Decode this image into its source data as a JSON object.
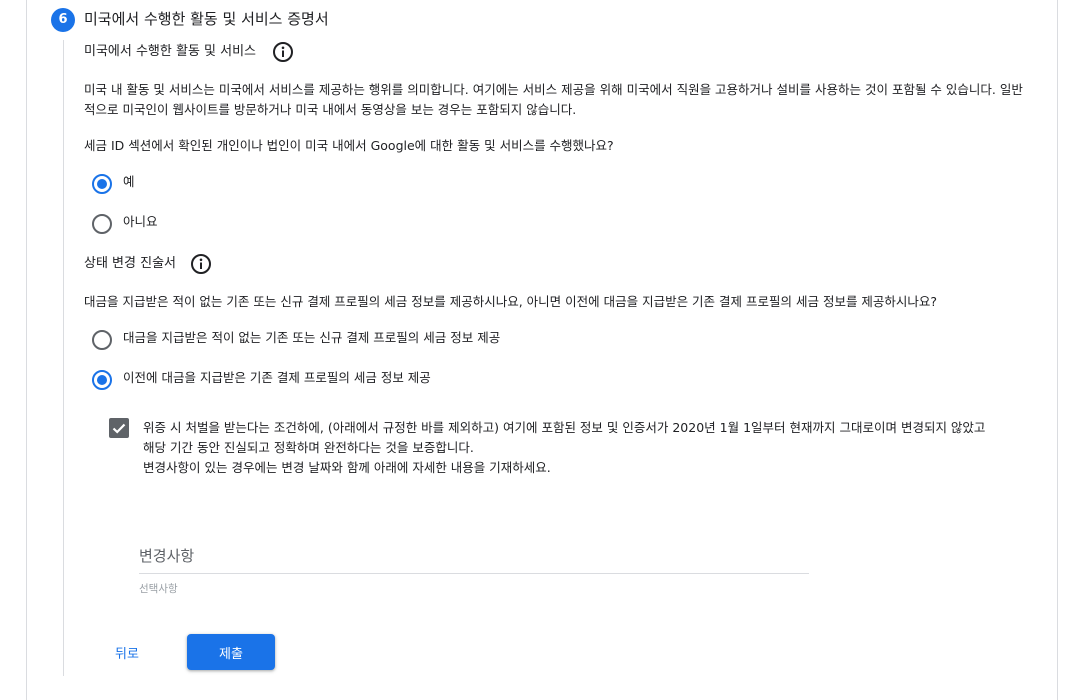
{
  "step": {
    "number": "6",
    "title": "미국에서 수행한 활동 및 서비스 증명서"
  },
  "activities": {
    "heading": "미국에서 수행한 활동 및 서비스",
    "info_icon": "info-icon",
    "description": "미국 내 활동 및 서비스는 미국에서 서비스를 제공하는 행위를 의미합니다. 여기에는 서비스 제공을 위해 미국에서 직원을 고용하거나 설비를 사용하는 것이 포함될 수 있습니다. 일반적으로 미국인이 웹사이트를 방문하거나 미국 내에서 동영상을 보는 경우는 포함되지 않습니다.",
    "question": "세금 ID 섹션에서 확인된 개인이나 법인이 미국 내에서 Google에 대한 활동 및 서비스를 수행했나요?",
    "options": [
      {
        "label": "예",
        "selected": true
      },
      {
        "label": "아니요",
        "selected": false
      }
    ]
  },
  "status_change": {
    "heading": "상태 변경 진술서",
    "info_icon": "info-icon",
    "question": "대금을 지급받은 적이 없는 기존 또는 신규 결제 프로필의 세금 정보를 제공하시나요, 아니면 이전에 대금을 지급받은 기존 결제 프로필의 세금 정보를 제공하시나요?",
    "options": [
      {
        "label": "대금을 지급받은 적이 없는 기존 또는 신규 결제 프로필의 세금 정보 제공",
        "selected": false
      },
      {
        "label": "이전에 대금을 지급받은 기존 결제 프로필의 세금 정보 제공",
        "selected": true
      }
    ]
  },
  "certification": {
    "checked": true,
    "line1": "위증 시 처벌을 받는다는 조건하에, (아래에서 규정한 바를 제외하고) 여기에 포함된 정보 및 인증서가 2020년 1월 1일부터 현재까지 그대로이며 변경되지 않았고",
    "line2": "해당 기간 동안 진실되고 정확하며 완전하다는 것을 보증합니다.",
    "line3": "변경사항이 있는 경우에는 변경 날짜와 함께 아래에 자세한 내용을 기재하세요."
  },
  "changes_field": {
    "label": "변경사항",
    "hint": "선택사항",
    "value": ""
  },
  "buttons": {
    "back": "뒤로",
    "submit": "제출"
  },
  "colors": {
    "accent": "#1a73e8",
    "text": "#202124",
    "muted": "#5f6368",
    "divider": "#dadce0"
  }
}
